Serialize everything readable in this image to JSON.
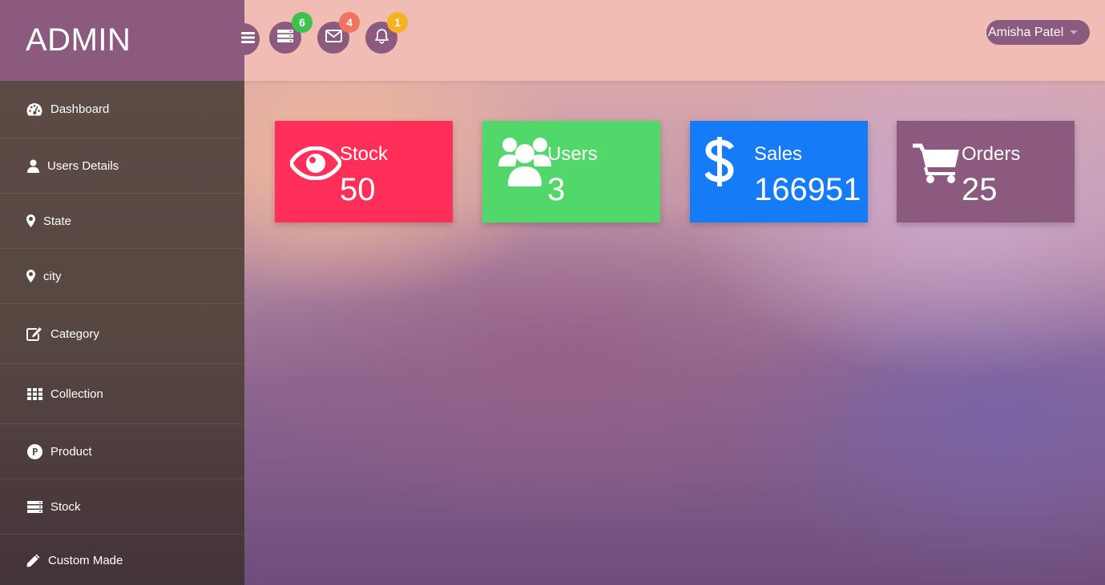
{
  "brand": {
    "title": "ADMIN"
  },
  "header": {
    "menu_icon": "hamburger-menu-icon",
    "notifications": [
      {
        "icon": "server-icon",
        "count": "6",
        "color": "#3ec24f"
      },
      {
        "icon": "envelope-icon",
        "count": "4",
        "color": "#f0745f"
      },
      {
        "icon": "bell-icon",
        "count": "1",
        "color": "#f5b221"
      }
    ],
    "user": {
      "name": "Amisha Patel"
    }
  },
  "sidebar": {
    "items": [
      {
        "label": "Dashboard",
        "icon": "dashboard-icon"
      },
      {
        "label": "Users Details",
        "icon": "user-icon"
      },
      {
        "label": "State",
        "icon": "map-marker-icon"
      },
      {
        "label": "city",
        "icon": "map-marker-icon"
      },
      {
        "label": "Category",
        "icon": "edit-icon"
      },
      {
        "label": "Collection",
        "icon": "grid-icon"
      },
      {
        "label": "Product",
        "icon": "product-icon"
      },
      {
        "label": "Stock",
        "icon": "server-icon"
      },
      {
        "label": "Custom Made",
        "icon": "pencil-icon"
      }
    ]
  },
  "cards": [
    {
      "title": "Stock",
      "value": "50",
      "icon": "eye-icon",
      "color": "#ff2f5a"
    },
    {
      "title": "Users",
      "value": "3",
      "icon": "users-icon",
      "color": "#52d86a"
    },
    {
      "title": "Sales",
      "value": "166951",
      "icon": "dollar-icon",
      "color": "#167bf6"
    },
    {
      "title": "Orders",
      "value": "25",
      "icon": "shopping-cart-icon",
      "color": "#8b5a7e"
    }
  ]
}
